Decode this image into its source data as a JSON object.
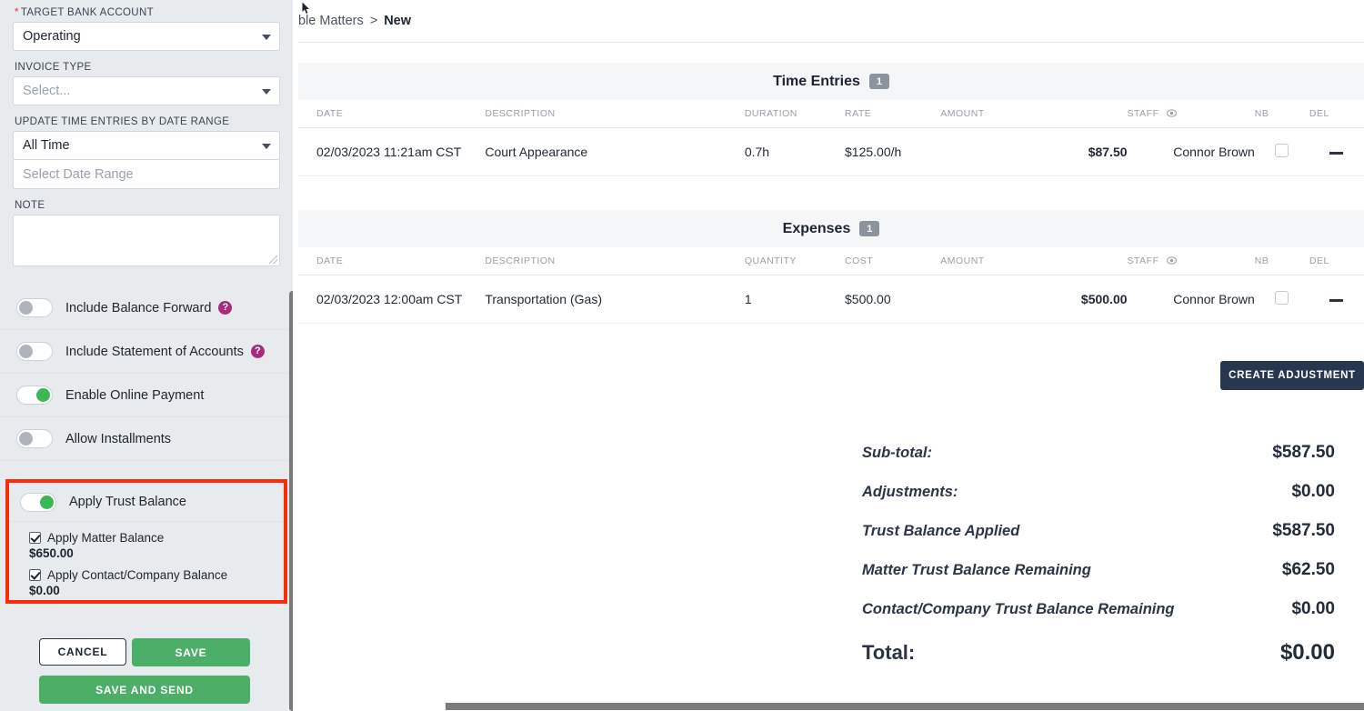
{
  "sidebar": {
    "target_bank_account": {
      "label": "TARGET BANK ACCOUNT",
      "required_mark": "*",
      "value": "Operating"
    },
    "invoice_type": {
      "label": "INVOICE TYPE",
      "placeholder": "Select...",
      "value": ""
    },
    "date_range": {
      "label": "UPDATE TIME ENTRIES BY DATE RANGE",
      "value": "All Time",
      "range_placeholder": "Select Date Range",
      "range_value": ""
    },
    "note": {
      "label": "NOTE",
      "value": ""
    },
    "toggles": [
      {
        "label": "Include Balance Forward",
        "state": "off",
        "help": "?"
      },
      {
        "label": "Include Statement of Accounts",
        "state": "off",
        "help": "?"
      },
      {
        "label": "Enable Online Payment",
        "state": "on",
        "help": ""
      },
      {
        "label": "Allow Installments",
        "state": "off",
        "help": ""
      }
    ],
    "trust": {
      "toggle_label": "Apply Trust Balance",
      "toggle_state": "on",
      "highlight_color": "#fc2b0a",
      "checkboxes": [
        {
          "label": "Apply Matter Balance",
          "amount": "$650.00",
          "checked": true
        },
        {
          "label": "Apply Contact/Company Balance",
          "amount": "$0.00",
          "checked": true
        }
      ]
    },
    "buttons": {
      "cancel": "CANCEL",
      "save": "SAVE",
      "save_and_send": "SAVE AND SEND"
    }
  },
  "main": {
    "breadcrumb": {
      "parent": "ble Matters",
      "separator": ">",
      "current": "New"
    },
    "time_entries": {
      "title": "Time Entries",
      "count": "1",
      "columns": [
        "DATE",
        "DESCRIPTION",
        "DURATION",
        "RATE",
        "AMOUNT",
        "STAFF",
        "NB",
        "DEL"
      ],
      "rows": [
        {
          "date": "02/03/2023 11:21am CST",
          "description": "Court Appearance",
          "duration": "0.7h",
          "rate": "$125.00/h",
          "amount": "$87.50",
          "staff": "Connor Brown",
          "nb": false,
          "del": "—"
        }
      ]
    },
    "expenses": {
      "title": "Expenses",
      "count": "1",
      "columns": [
        "DATE",
        "DESCRIPTION",
        "QUANTITY",
        "COST",
        "AMOUNT",
        "STAFF",
        "NB",
        "DEL"
      ],
      "rows": [
        {
          "date": "02/03/2023 12:00am CST",
          "description": "Transportation (Gas)",
          "quantity": "1",
          "cost": "$500.00",
          "amount": "$500.00",
          "staff": "Connor Brown",
          "nb": false,
          "del": "—"
        }
      ]
    },
    "create_adjustment_label": "CREATE ADJUSTMENT",
    "totals": [
      {
        "label": "Sub-total:",
        "value": "$587.50"
      },
      {
        "label": "Adjustments:",
        "value": "$0.00"
      },
      {
        "label": "Trust Balance Applied",
        "value": "$587.50"
      },
      {
        "label": "Matter Trust Balance Remaining",
        "value": "$62.50"
      },
      {
        "label": "Contact/Company Trust Balance Remaining",
        "value": "$0.00"
      }
    ],
    "grand_total": {
      "label": "Total:",
      "value": "$0.00"
    }
  },
  "colors": {
    "accent_green": "#4caf68",
    "dark_navy": "#26374f",
    "help_magenta": "#a72a7c",
    "highlight_red": "#fc2b0a"
  }
}
